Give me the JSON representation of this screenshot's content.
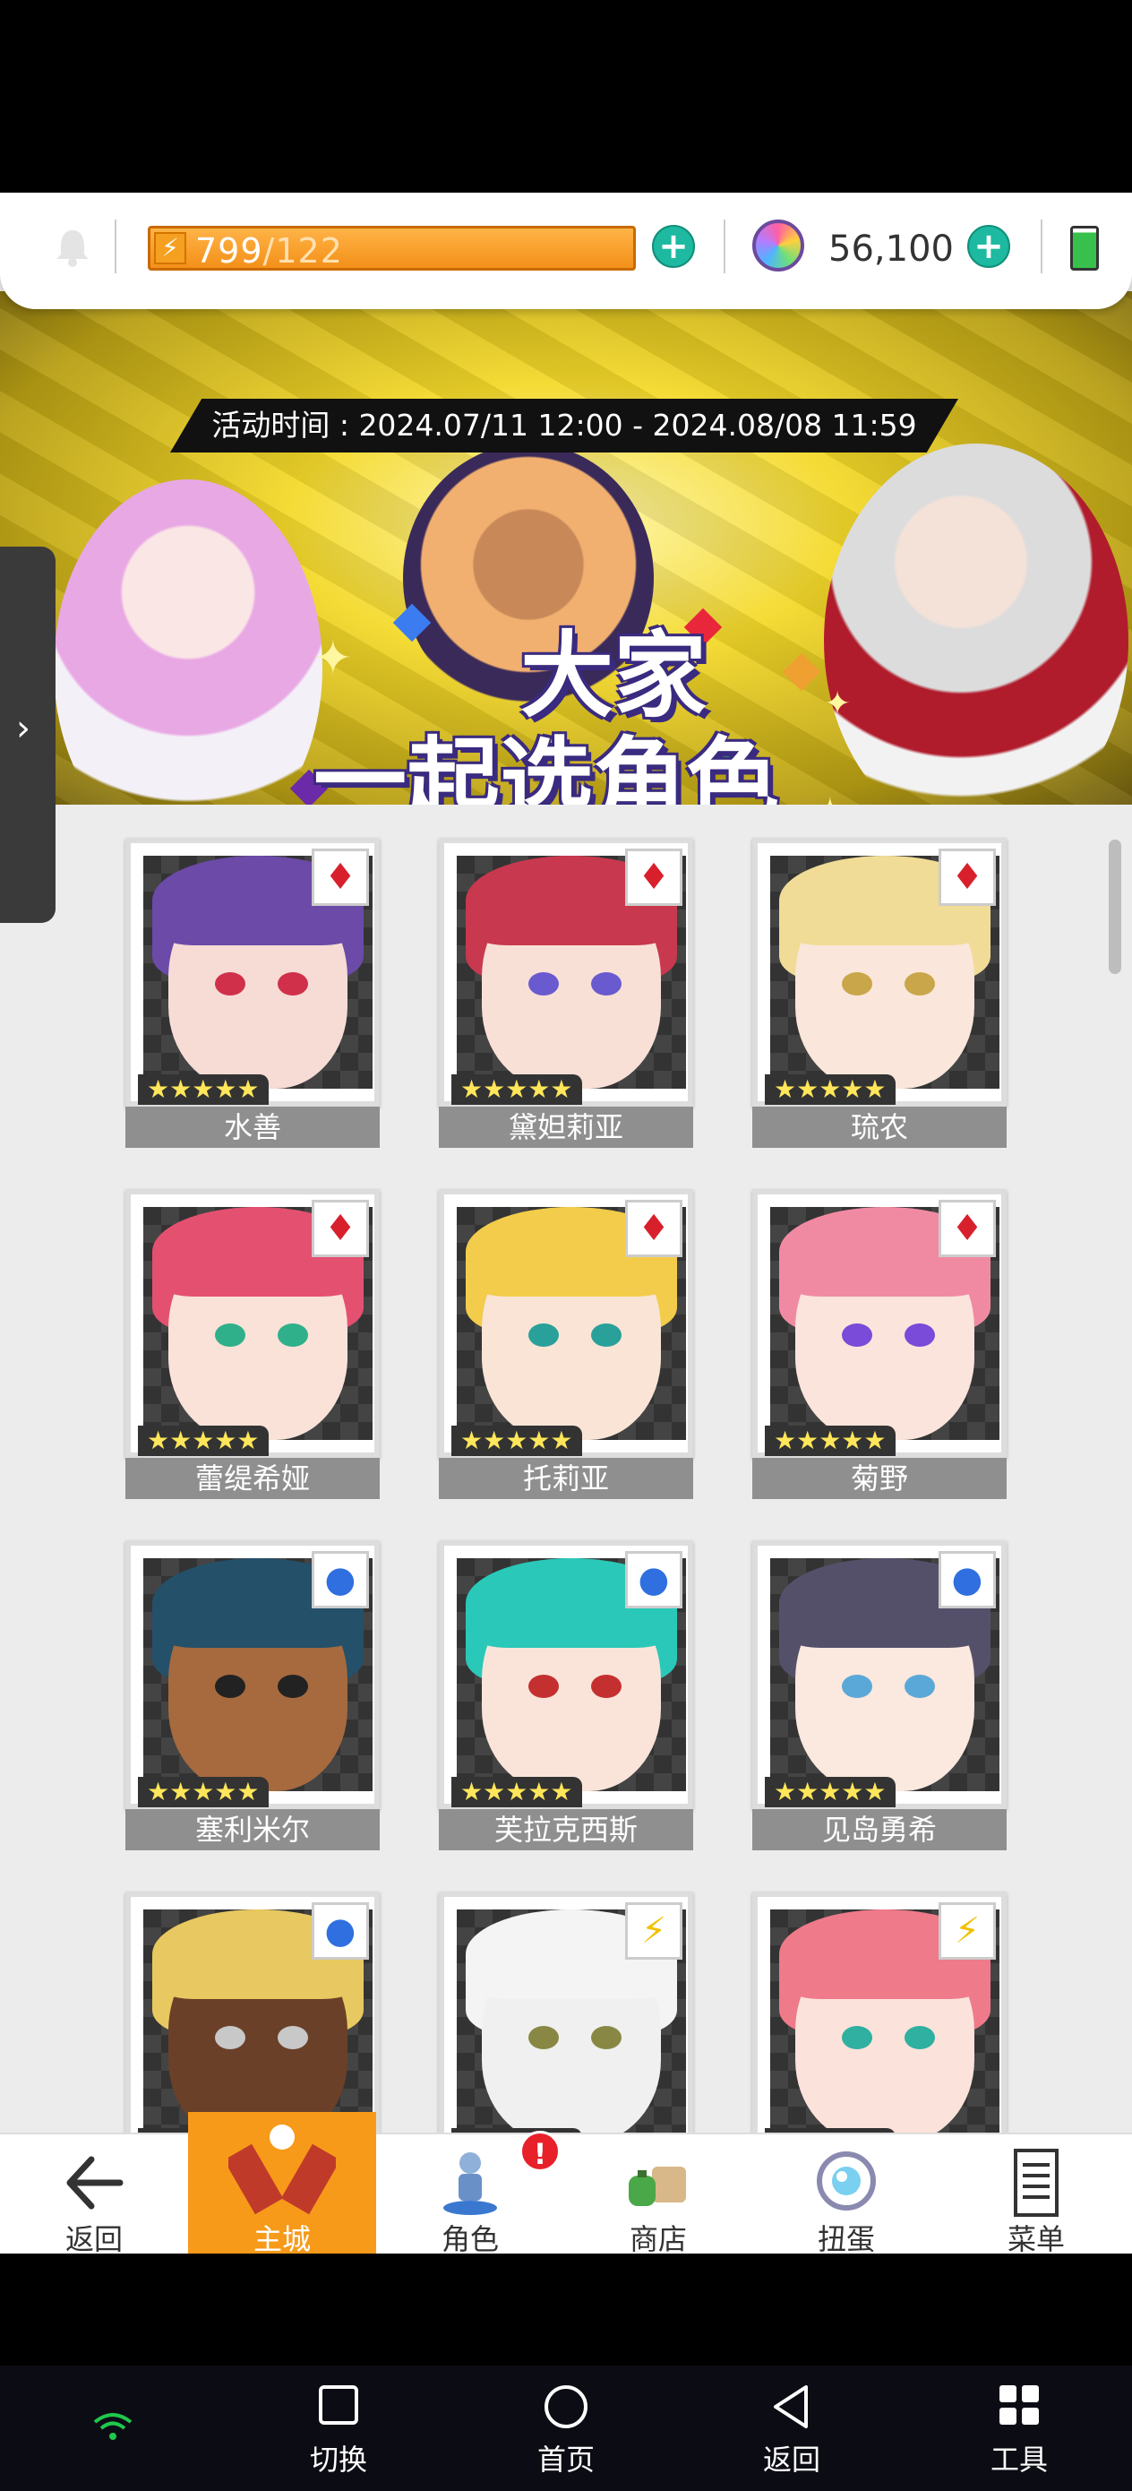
{
  "header": {
    "stamina_current": "799",
    "stamina_max": "/122",
    "gems": "56,100",
    "plus_glyph": "+"
  },
  "banner": {
    "event_time": "活动时间 : 2024.07/11 12:00 - 2024.08/08 11:59",
    "title_line1": "大家",
    "title_line2": "一起选角色"
  },
  "characters": [
    {
      "name": "水善",
      "attribute": "red",
      "attr_glyph": "♦",
      "stars": "★★★★★",
      "hair": "#6b4aa8",
      "skin": "#f6dcd4",
      "eyes": "#d0304a"
    },
    {
      "name": "黛妲莉亚",
      "attribute": "red",
      "attr_glyph": "♦",
      "stars": "★★★★★",
      "hair": "#c8384e",
      "skin": "#f8e0d6",
      "eyes": "#6a5ad0"
    },
    {
      "name": "琉农",
      "attribute": "red",
      "attr_glyph": "♦",
      "stars": "★★★★★",
      "hair": "#f0dc96",
      "skin": "#fae6da",
      "eyes": "#c9a64a"
    },
    {
      "name": "蕾缇希娅",
      "attribute": "red",
      "attr_glyph": "♦",
      "stars": "★★★★★",
      "hair": "#e45070",
      "skin": "#fae2d8",
      "eyes": "#2fb08a"
    },
    {
      "name": "托莉亚",
      "attribute": "red",
      "attr_glyph": "♦",
      "stars": "★★★★★",
      "hair": "#f2cc4a",
      "skin": "#fae4d6",
      "eyes": "#2aa09a"
    },
    {
      "name": "菊野",
      "attribute": "red",
      "attr_glyph": "♦",
      "stars": "★★★★★",
      "hair": "#f08aa2",
      "skin": "#fbe4dc",
      "eyes": "#7a4ad8"
    },
    {
      "name": "塞利米尔",
      "attribute": "blue",
      "attr_glyph": "●",
      "stars": "★★★★★",
      "hair": "#24506a",
      "skin": "#a66a3e",
      "eyes": "#222222"
    },
    {
      "name": "芙拉克西斯",
      "attribute": "blue",
      "attr_glyph": "●",
      "stars": "★★★★★",
      "hair": "#2ac8b8",
      "skin": "#fae4da",
      "eyes": "#c43030"
    },
    {
      "name": "见岛勇希",
      "attribute": "blue",
      "attr_glyph": "●",
      "stars": "★★★★★",
      "hair": "#55506a",
      "skin": "#fbe8de",
      "eyes": "#5aa8d8"
    },
    {
      "name": "",
      "attribute": "blue",
      "attr_glyph": "●",
      "stars": "★★★★★",
      "hair": "#e8c860",
      "skin": "#6a4028",
      "eyes": "#c8c8c8"
    },
    {
      "name": "",
      "attribute": "yellow",
      "attr_glyph": "⚡",
      "stars": "★★★★★",
      "hair": "#f4f4f4",
      "skin": "#f0f0f0",
      "eyes": "#888844"
    },
    {
      "name": "",
      "attribute": "yellow",
      "attr_glyph": "⚡",
      "stars": "★★★★★",
      "hair": "#ee7a8a",
      "skin": "#fbe2da",
      "eyes": "#2fb0a0"
    }
  ],
  "game_nav": [
    {
      "label": "返回",
      "icon": "back-arrow-icon"
    },
    {
      "label": "主城",
      "icon": "castle-icon",
      "active": true
    },
    {
      "label": "角色",
      "icon": "character-icon",
      "badge": "!"
    },
    {
      "label": "商店",
      "icon": "shop-bag-icon"
    },
    {
      "label": "扭蛋",
      "icon": "gacha-icon"
    },
    {
      "label": "菜单",
      "icon": "menu-list-icon"
    }
  ],
  "system_nav": [
    {
      "label": "切换",
      "icon": "recents-icon"
    },
    {
      "label": "首页",
      "icon": "home-icon"
    },
    {
      "label": "返回",
      "icon": "back-icon"
    },
    {
      "label": "工具",
      "icon": "tools-grid-icon"
    }
  ],
  "colors": {
    "accent_orange": "#f79a1a",
    "teal_plus": "#1db9a0",
    "badge_red": "#e8202a"
  }
}
